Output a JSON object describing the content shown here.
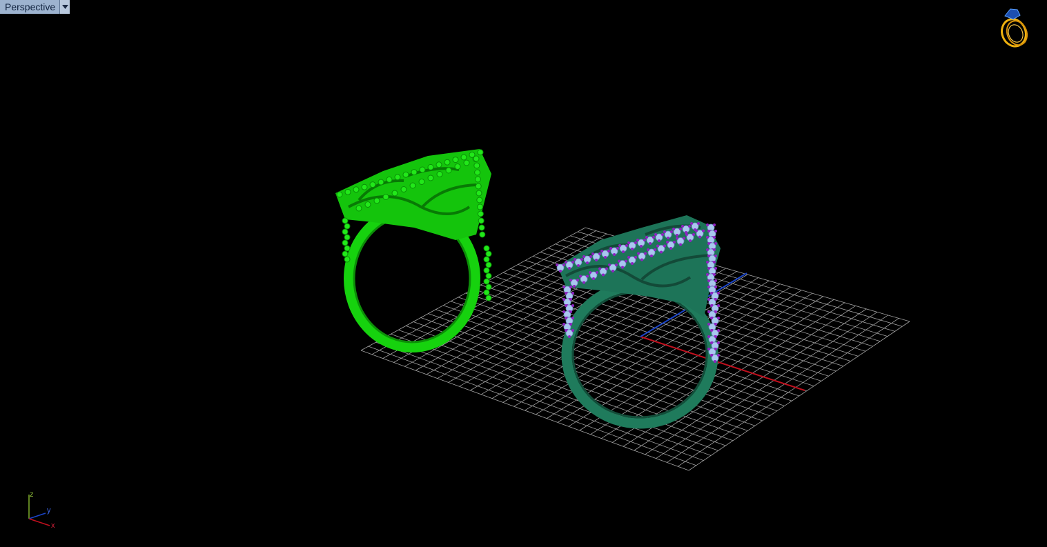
{
  "viewport": {
    "name": "Perspective",
    "background_color": "#000000"
  },
  "scene": {
    "grid_color": "#bfbfbf",
    "axis_colors": {
      "x": "#c0101e",
      "y": "#1a44c8",
      "z": "#7fae2a"
    },
    "objects": [
      {
        "name": "ring-left",
        "metal_color": "#16d20e",
        "stone_color": "#16d20e",
        "state": "unselected"
      },
      {
        "name": "ring-right",
        "metal_color": "#1f7b5c",
        "stone_color": "#a9c7ef",
        "prong_color": "#8e23c2",
        "state": "highlighted"
      }
    ]
  },
  "axis_indicator": {
    "z_label": "z",
    "y_label": "y",
    "x_label": "x"
  },
  "logo_icon": "gold-ring-icon"
}
